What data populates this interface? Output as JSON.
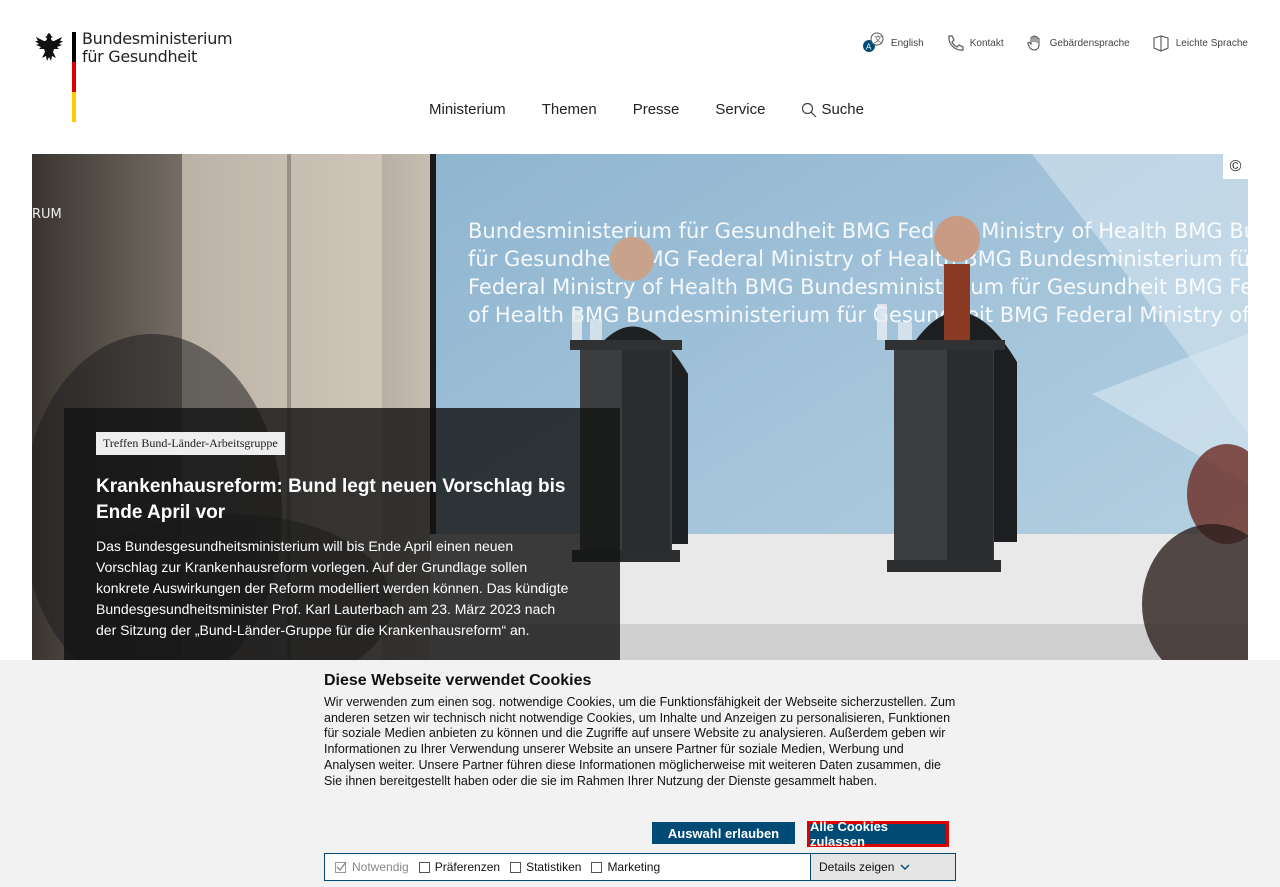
{
  "logo": {
    "line1": "Bundesministerium",
    "line2": "für Gesundheit"
  },
  "utility_nav": [
    {
      "label": "English",
      "icon": "language-icon"
    },
    {
      "label": "Kontakt",
      "icon": "phone-icon"
    },
    {
      "label": "Gebärdensprache",
      "icon": "hand-icon"
    },
    {
      "label": "Leichte Sprache",
      "icon": "book-icon"
    }
  ],
  "main_nav": [
    "Ministerium",
    "Themen",
    "Presse",
    "Service",
    "Suche"
  ],
  "hero": {
    "copyright": "©",
    "kicker": "Treffen Bund-Länder-Arbeitsgruppe",
    "headline": "Krankenhausreform: Bund legt neuen Vorschlag bis Ende April vor",
    "body": "Das Bundesgesundheitsministerium will bis Ende April einen neuen Vorschlag zur Krankenhausreform vorlegen. Auf der Grundlage sollen konkrete Auswirkungen der Reform modelliert werden können. Das kündigte Bundesgesundheitsminister Prof. Karl Lauterbach am 23. März 2023 nach der Sitzung der „Bund-Länder-Gruppe für die Krankenhausreform“ an.",
    "backdrop_lines": [
      "Bundesministerium für Gesundheit BMG Federal Ministry of Health BMG Bundes",
      "für Gesundheit BMG Federal Ministry of Health BMG Bundesministerium für Ges",
      "Federal Ministry of Health BMG Bundesministerium für Gesundheit BMG Fed",
      "of Health BMG Bundesministerium für Gesundheit BMG Federal Ministry of"
    ],
    "wall_text": "RUM"
  },
  "cookie": {
    "title": "Diese Webseite verwendet Cookies",
    "text": "Wir verwenden zum einen sog. notwendige Cookies, um die Funktionsfähigkeit der Webseite sicherzustellen. Zum anderen setzen wir technisch nicht notwendige Cookies, um Inhalte und Anzeigen zu personalisieren, Funktionen für soziale Medien anbieten zu können und die Zugriffe auf unsere Website zu analysieren. Außerdem geben wir Informationen zu Ihrer Verwendung unserer Website an unsere Partner für soziale Medien, Werbung und Analysen weiter. Unsere Partner führen diese Informationen möglicherweise mit weiteren Daten zusammen, die Sie ihnen bereitgestellt haben oder die sie im Rahmen Ihrer Nutzung der Dienste gesammelt haben.",
    "btn_selection": "Auswahl erlauben",
    "btn_all": "Alle Cookies zulassen",
    "options": [
      "Notwendig",
      "Präferenzen",
      "Statistiken",
      "Marketing"
    ],
    "details": "Details zeigen"
  },
  "colors": {
    "accent": "#004b76",
    "highlight_border": "#e10000",
    "flag_black": "#000000",
    "flag_red": "#dd0000",
    "flag_gold": "#ffcc00"
  }
}
